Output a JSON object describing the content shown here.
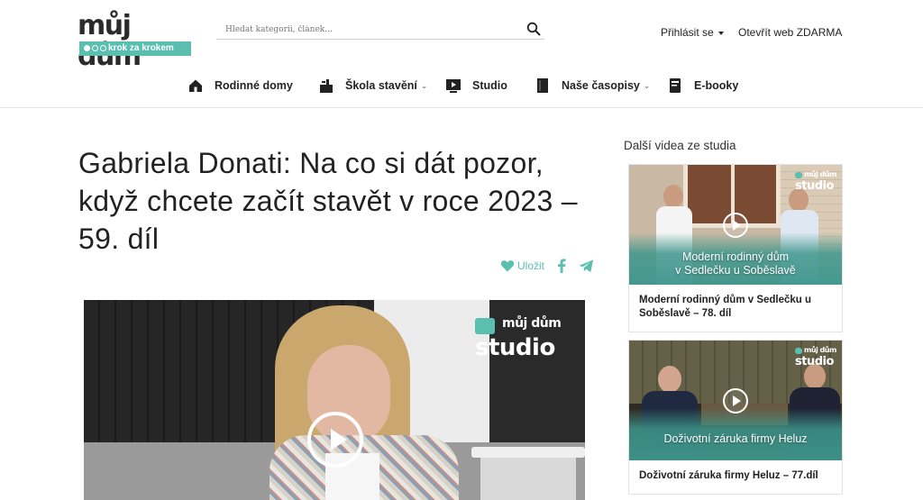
{
  "header": {
    "logo_main": "můj dům",
    "logo_tagline": "krok za krokem",
    "search_placeholder": "Hledat kategorii, článek...",
    "login_label": "Přihlásit se",
    "open_web_label": "Otevřít web ZDARMA"
  },
  "nav": {
    "items": [
      {
        "label": "Rodinné domy",
        "icon": "house-icon"
      },
      {
        "label": "Škola stavění",
        "icon": "building-icon",
        "has_submenu": true
      },
      {
        "label": "Studio",
        "icon": "video-icon"
      },
      {
        "label": "Naše časopisy",
        "icon": "magazine-icon",
        "has_submenu": true
      },
      {
        "label": "E-booky",
        "icon": "ebook-icon"
      }
    ]
  },
  "article": {
    "title": "Gabriela Donati: Na co si dát pozor, když chcete začít stavět v roce 2023 – 59. díl",
    "save_label": "Uložit",
    "video_brand_top": "můj dům",
    "video_brand_bottom": "studio"
  },
  "sidebar": {
    "title": "Další videa ze studia",
    "cards": [
      {
        "thumb_text_line1": "Moderní rodinný dům",
        "thumb_text_line2": "v Sedlečku u Soběslavě",
        "caption": "Moderní rodinný dům v Sedlečku u Soběslavě – 78. díl",
        "brand_top": "můj dům",
        "brand_bottom": "studio"
      },
      {
        "thumb_text_line1": "Doživotní záruka firmy Heluz",
        "thumb_text_line2": "",
        "caption": "Doživotní záruka firmy Heluz – 77.díl",
        "brand_top": "můj dům",
        "brand_bottom": "studio"
      }
    ]
  },
  "colors": {
    "accent": "#5bbfb0",
    "text": "#222222"
  }
}
